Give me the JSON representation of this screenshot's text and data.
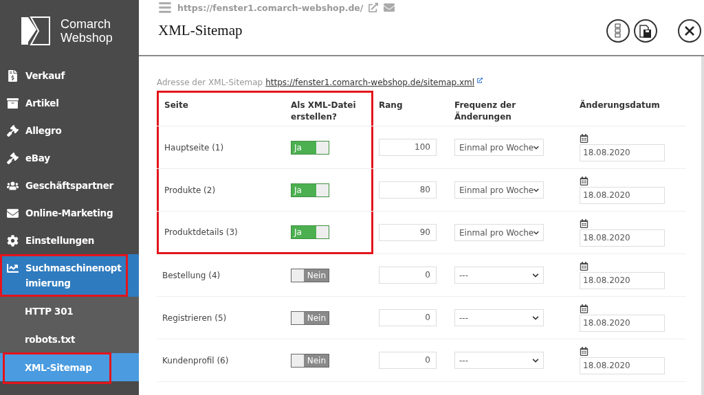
{
  "sidebar": {
    "logo": [
      "Comarch",
      "Webshop"
    ],
    "items": [
      {
        "label": "Verkauf",
        "selected": false,
        "highlighted": false
      },
      {
        "label": "Artikel",
        "selected": false,
        "highlighted": false
      },
      {
        "label": "Allegro",
        "selected": false,
        "highlighted": false
      },
      {
        "label": "eBay",
        "selected": false,
        "highlighted": false
      },
      {
        "label": "Geschäftspartner",
        "selected": false,
        "highlighted": false
      },
      {
        "label": "Online-Marketing",
        "selected": false,
        "highlighted": false
      },
      {
        "label": "Einstellungen",
        "selected": false,
        "highlighted": false
      },
      {
        "label": "Suchmaschinenoptimierung",
        "selected": true,
        "highlighted": true,
        "expanded": true,
        "children": [
          {
            "label": "HTTP 301",
            "selected": false,
            "highlighted": false
          },
          {
            "label": "robots.txt",
            "selected": false,
            "highlighted": false
          },
          {
            "label": "XML-Sitemap",
            "selected": true,
            "highlighted": true
          }
        ]
      }
    ]
  },
  "header": {
    "url": "https://fenster1.comarch-webshop.de/",
    "title": "XML-Sitemap"
  },
  "sitemap_address": {
    "label": "Adresse der XML-Sitemap",
    "link": "https://fenster1.comarch-webshop.de/sitemap.xml"
  },
  "table": {
    "columns": [
      "Seite",
      "Als XML-Datei erstellen?",
      "Rang",
      "Frequenz der Änderungen",
      "Änderungsdatum"
    ],
    "rows": [
      {
        "page": "Hauptseite (1)",
        "on": true,
        "toggle_label": "Ja",
        "rank": "100",
        "frequency": "Einmal pro Woche",
        "date": "18.08.2020",
        "highlighted": true
      },
      {
        "page": "Produkte (2)",
        "on": true,
        "toggle_label": "Ja",
        "rank": "80",
        "frequency": "Einmal pro Woche",
        "date": "18.08.2020",
        "highlighted": true
      },
      {
        "page": "Produktdetails (3)",
        "on": true,
        "toggle_label": "Ja",
        "rank": "90",
        "frequency": "Einmal pro Woche",
        "date": "18.08.2020",
        "highlighted": true
      },
      {
        "page": "Bestellung (4)",
        "on": false,
        "toggle_label": "Nein",
        "rank": "0",
        "frequency": "---",
        "date": "18.08.2020",
        "highlighted": false
      },
      {
        "page": "Registrieren (5)",
        "on": false,
        "toggle_label": "Nein",
        "rank": "0",
        "frequency": "---",
        "date": "18.08.2020",
        "highlighted": false
      },
      {
        "page": "Kundenprofil (6)",
        "on": false,
        "toggle_label": "Nein",
        "rank": "0",
        "frequency": "---",
        "date": "18.08.2020",
        "highlighted": false
      }
    ]
  }
}
